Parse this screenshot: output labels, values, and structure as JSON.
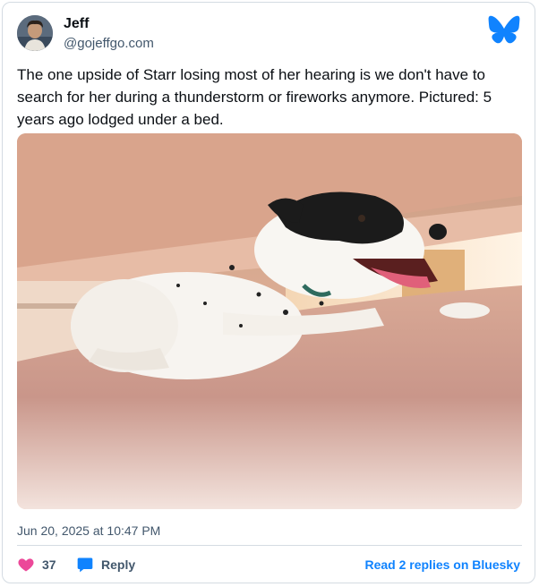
{
  "author": {
    "name": "Jeff",
    "handle": "@gojeffgo.com",
    "avatar_icon": "profile-photo"
  },
  "post": {
    "text": "The one upside of Starr losing most of her hearing is we don't have to search for her during a thunderstorm or fireworks anymore. Pictured: 5 years ago lodged under a bed.",
    "image_description_icon": "dog-under-bed-photo",
    "timestamp": "Jun 20, 2025 at 10:47 PM"
  },
  "actions": {
    "like_count": "37",
    "reply_label": "Reply",
    "read_replies_label": "Read 2 replies on Bluesky"
  },
  "colors": {
    "brand_blue": "#1083fe",
    "like_pink": "#ec4899",
    "secondary_text": "#42576c",
    "border": "#d4dbe2"
  },
  "icons": {
    "logo": "bluesky-butterfly-icon",
    "like": "heart-icon",
    "reply": "speech-bubble-icon"
  }
}
